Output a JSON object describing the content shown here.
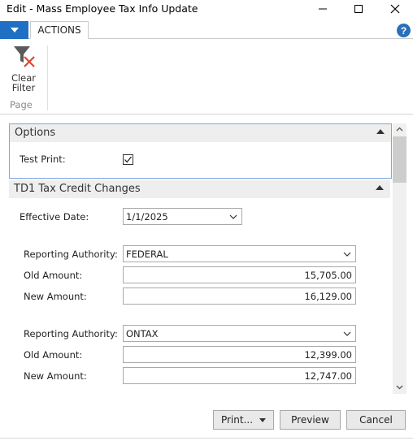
{
  "window": {
    "title": "Edit - Mass Employee Tax Info Update",
    "minimize_icon": "minimize-icon",
    "maximize_icon": "maximize-icon",
    "close_icon": "close-icon"
  },
  "ribbon": {
    "tabs": [
      {
        "label": "ACTIONS"
      }
    ],
    "clear_filter_label_line1": "Clear",
    "clear_filter_label_line2": "Filter",
    "group_label": "Page",
    "help_label": "?"
  },
  "options": {
    "title": "Options",
    "test_print_label": "Test Print:",
    "test_print_checked": true
  },
  "td1": {
    "title": "TD1 Tax Credit Changes",
    "effective_date_label": "Effective Date:",
    "effective_date": "1/1/2025",
    "groups": [
      {
        "authority_label": "Reporting Authority:",
        "authority": "FEDERAL",
        "old_label": "Old Amount:",
        "old_amount": "15,705.00",
        "new_label": "New Amount:",
        "new_amount": "16,129.00"
      },
      {
        "authority_label": "Reporting Authority:",
        "authority": "ONTAX",
        "old_label": "Old Amount:",
        "old_amount": "12,399.00",
        "new_label": "New Amount:",
        "new_amount": "12,747.00"
      }
    ]
  },
  "footer": {
    "print_label": "Print...",
    "preview_label": "Preview",
    "cancel_label": "Cancel"
  },
  "colors": {
    "accent": "#1f6fc5",
    "options_border": "#7aa7dd",
    "clear_filter_x": "#e0432f"
  }
}
